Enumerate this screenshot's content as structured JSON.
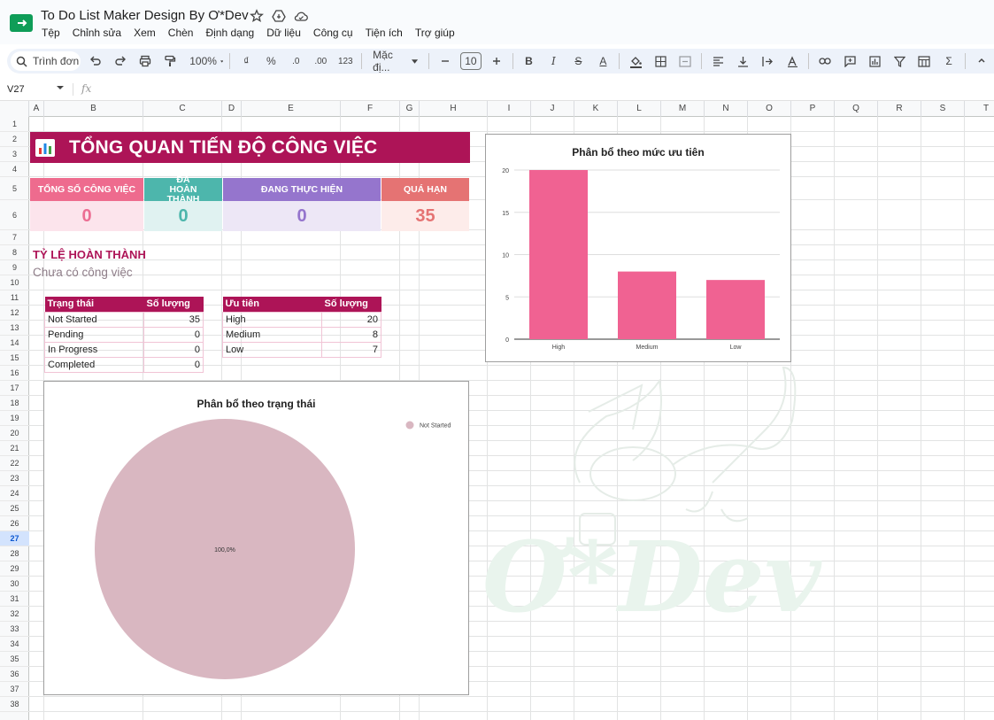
{
  "app": {
    "title": "To Do List Maker Design By Ơ*Dev",
    "menu": [
      "Tệp",
      "Chỉnh sửa",
      "Xem",
      "Chèn",
      "Định dạng",
      "Dữ liệu",
      "Công cụ",
      "Tiện ích",
      "Trợ giúp"
    ]
  },
  "toolbar": {
    "search_label": "Trình đơn",
    "zoom": "100%",
    "currency": "₫",
    "percent": "%",
    "dec_decrease": ".0",
    "dec_increase": ".00",
    "number_format": "123",
    "font": "Mặc đị...",
    "font_size": "10",
    "bold": "B",
    "italic": "I",
    "strike": "S",
    "text_color": "A",
    "sum": "Σ"
  },
  "formula_bar": {
    "cell_ref": "V27",
    "fx": "fx"
  },
  "columns": [
    "A",
    "B",
    "C",
    "D",
    "E",
    "F",
    "G",
    "H",
    "I",
    "J",
    "K",
    "L",
    "M",
    "N",
    "O",
    "P",
    "Q",
    "R",
    "S",
    "T"
  ],
  "rows": [
    "1",
    "2",
    "3",
    "4",
    "5",
    "6",
    "7",
    "8",
    "9",
    "10",
    "11",
    "12",
    "13",
    "14",
    "15",
    "16",
    "17",
    "18",
    "19",
    "20",
    "21",
    "22",
    "23",
    "24",
    "25",
    "26",
    "27",
    "28",
    "29",
    "30",
    "31",
    "32",
    "33",
    "34",
    "35",
    "36",
    "37",
    "38"
  ],
  "active_row": "27",
  "dashboard": {
    "title": "TỔNG QUAN TIẾN ĐỘ CÔNG VIỆC",
    "icon": "bar-chart-icon",
    "kpis": [
      {
        "label": "TỔNG SỐ CÔNG VIỆC",
        "value": "0",
        "header_color": "#ee6b8e",
        "body_color": "#fce4ec",
        "value_color": "#ec6e93"
      },
      {
        "label": "ĐÃ HOÀN THÀNH",
        "value": "0",
        "header_color": "#4db6ac",
        "body_color": "#e0f2f1",
        "value_color": "#4db6ac"
      },
      {
        "label": "ĐANG THỰC HIỆN",
        "value": "0",
        "header_color": "#9575cd",
        "body_color": "#ede7f6",
        "value_color": "#9575cd"
      },
      {
        "label": "QUÁ HẠN",
        "value": "35",
        "header_color": "#e57373",
        "body_color": "#fdecea",
        "value_color": "#e57373"
      }
    ],
    "rate_title": "TỶ LỆ HOÀN THÀNH",
    "rate_subtitle": "Chưa có công việc"
  },
  "status_table": {
    "headers": [
      "Trạng thái",
      "Số lượng"
    ],
    "rows": [
      [
        "Not Started",
        "35"
      ],
      [
        "Pending",
        "0"
      ],
      [
        "In Progress",
        "0"
      ],
      [
        "Completed",
        "0"
      ]
    ]
  },
  "priority_table": {
    "headers": [
      "Ưu tiên",
      "Số lượng"
    ],
    "rows": [
      [
        "High",
        "20"
      ],
      [
        "Medium",
        "8"
      ],
      [
        "Low",
        "7"
      ]
    ]
  },
  "chart_data": [
    {
      "type": "bar",
      "title": "Phân bổ theo mức ưu tiên",
      "categories": [
        "High",
        "Medium",
        "Low"
      ],
      "values": [
        20,
        8,
        7
      ],
      "ylim": [
        0,
        20
      ],
      "yticks": [
        "0",
        "5",
        "10",
        "15",
        "20"
      ],
      "grid": true,
      "color": "#f06292"
    },
    {
      "type": "pie",
      "title": "Phân bổ theo trạng thái",
      "categories": [
        "Not Started"
      ],
      "values": [
        35
      ],
      "slice_label": "100,0%",
      "legend": "top-right",
      "color": "#d9b7c1"
    }
  ],
  "watermark": {
    "text": "Ơ*Dev",
    "color": "#e8f3ec"
  }
}
